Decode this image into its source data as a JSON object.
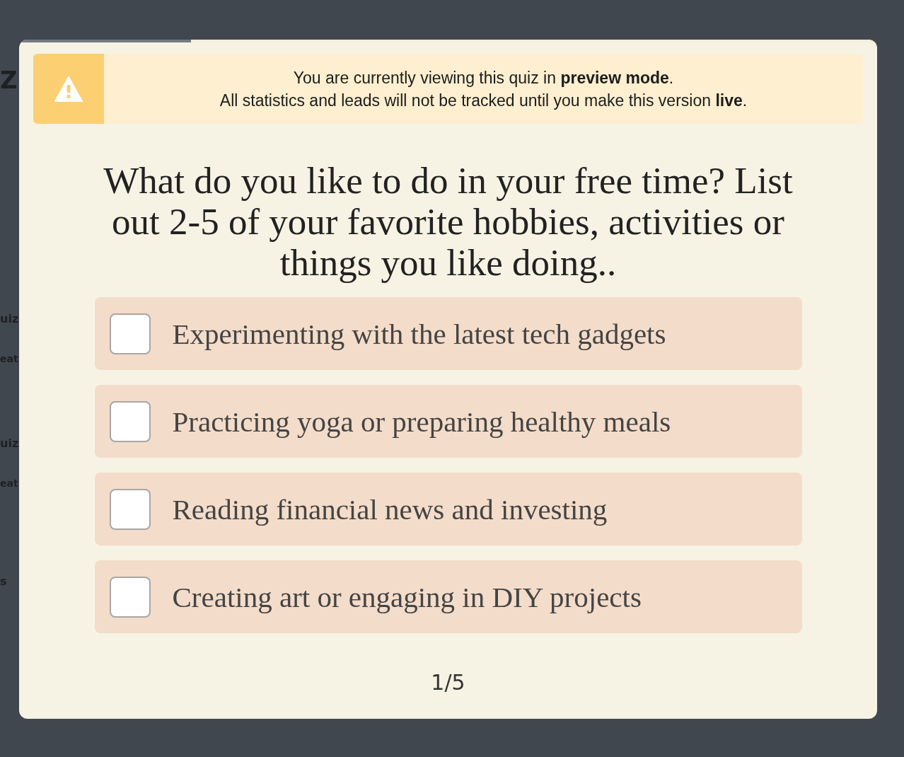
{
  "background_page": {
    "fragments": [
      {
        "kind": "heading",
        "text": "Z"
      },
      {
        "kind": "title",
        "text": "uiz"
      },
      {
        "kind": "subtitle",
        "text": "eat"
      },
      {
        "kind": "title",
        "text": "uiz"
      },
      {
        "kind": "subtitle",
        "text": "eat"
      },
      {
        "kind": "title",
        "text": "s"
      }
    ]
  },
  "modal": {
    "progress": {
      "level": 0.2
    },
    "notice": {
      "lines": [
        "You are currently viewing this quiz in **preview mode**.",
        "All statistics and leads will not be tracked until you make this version **live**."
      ]
    },
    "question": "What do you like to do in your free time? List out 2-5 of your favorite hobbies, activities or things you like doing..",
    "options": [
      {
        "label": "Experimenting with the latest tech gadgets",
        "checked": false
      },
      {
        "label": "Practicing yoga or preparing healthy meals",
        "checked": false
      },
      {
        "label": "Reading financial news and investing",
        "checked": false
      },
      {
        "label": "Creating art or engaging in DIY projects",
        "checked": false
      }
    ],
    "step": "1/5"
  }
}
